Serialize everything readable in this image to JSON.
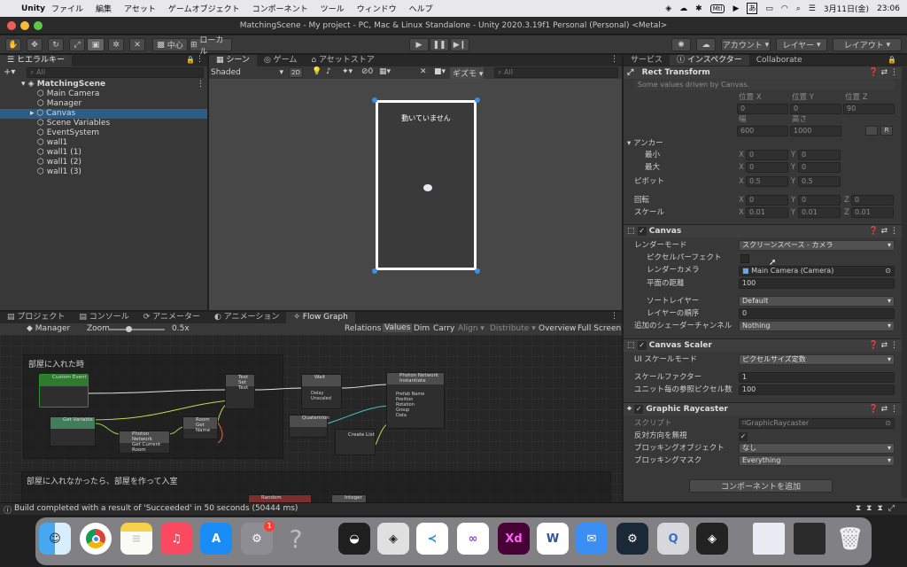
{
  "menubar": {
    "apple": "",
    "app": "Unity",
    "items": [
      "ファイル",
      "編集",
      "アセット",
      "ゲームオブジェクト",
      "コンポーネント",
      "ツール",
      "ウィンドウ",
      "ヘルプ"
    ],
    "date": "3月11日(金)",
    "time": "23:06",
    "input_method": "あ"
  },
  "window": {
    "title": "MatchingScene - My project - PC, Mac & Linux Standalone - Unity 2020.3.19f1 Personal (Personal) <Metal>"
  },
  "toolbar": {
    "pivot": "中心",
    "space": "ローカル",
    "account": "アカウント",
    "layers": "レイヤー",
    "layout": "レイアウト"
  },
  "hierarchy": {
    "tab": "ヒエラルキー",
    "search_placeholder": "All",
    "scene": "MatchingScene",
    "items": [
      "Main Camera",
      "Manager",
      "Canvas",
      "Scene Variables",
      "EventSystem",
      "wall1",
      "wall1 (1)",
      "wall1 (2)",
      "wall1 (3)"
    ],
    "selected": "Canvas"
  },
  "scene": {
    "tabs": [
      "シーン",
      "ゲーム",
      "アセットストア"
    ],
    "mode": "Shaded",
    "btn_2d": "2D",
    "gizmos": "ギズモ",
    "search_placeholder": "All",
    "label": "動いていません"
  },
  "bottom": {
    "tabs": [
      "プロジェクト",
      "コンソール",
      "アニメーター",
      "アニメーション",
      "Flow Graph"
    ],
    "graph_target": "Manager",
    "zoom_label": "Zoom",
    "zoom_value": "0.5x",
    "buttons": [
      "Relations",
      "Values",
      "Dim",
      "Carry",
      "Align ▾",
      "Distribute ▾",
      "Overview",
      "Full Screen"
    ],
    "group1": "部屋に入れた時",
    "group2": "部屋に入れなかったら、部屋を作って入室",
    "nodes": {
      "custom_event": "Custom Event",
      "get_variable": "Get Variable",
      "photon_room": "Photon Network",
      "photon_room_sub": "Get Current Room",
      "room": "Room",
      "room_sub": "Get Name",
      "text": "Text",
      "text_sub": "Set Text",
      "wait": "Wait",
      "wait_p1": "Delay",
      "wait_p2": "Unscaled",
      "quaternion": "Quaternion",
      "create_list": "Create List",
      "inst": "Photon Network",
      "inst_sub": "Instantiate",
      "inst_p1": "Prefab Name",
      "inst_p2": "Position",
      "inst_p3": "Rotation",
      "inst_p4": "Group",
      "inst_p5": "Data",
      "random": "Random",
      "integer": "Integer"
    }
  },
  "statusbar": {
    "message": "Build completed with a result of 'Succeeded' in 50 seconds (50444 ms)"
  },
  "inspector": {
    "tabs": [
      "サービス",
      "インスペクター",
      "Collaborate"
    ],
    "rect": {
      "title": "Rect Transform",
      "note": "Some values driven by Canvas.",
      "pos_x_label": "位置 X",
      "pos_y_label": "位置 Y",
      "pos_z_label": "位置 Z",
      "pos_x": "0",
      "pos_y": "0",
      "pos_z": "90",
      "w_label": "幅",
      "h_label": "高さ",
      "w": "600",
      "h": "1000",
      "r_btn": "R",
      "anchor": "アンカー",
      "min": "最小",
      "max": "最大",
      "min_x": "0",
      "min_y": "0",
      "max_x": "0",
      "max_y": "0",
      "pivot": "ピボット",
      "pivot_x": "0.5",
      "pivot_y": "0.5",
      "rotation": "回転",
      "rot_x": "0",
      "rot_y": "0",
      "rot_z": "0",
      "scale": "スケール",
      "sx": "0.01",
      "sy": "0.01",
      "sz": "0.01",
      "x": "X",
      "y": "Y",
      "z": "Z"
    },
    "canvas": {
      "title": "Canvas",
      "render_mode_label": "レンダーモード",
      "render_mode": "スクリーンスペース - カメラ",
      "pixel_perfect": "ピクセルパーフェクト",
      "render_camera_label": "レンダーカメラ",
      "render_camera": "Main Camera (Camera)",
      "plane_distance_label": "平面の距離",
      "plane_distance": "100",
      "sorting_layer_label": "ソートレイヤー",
      "sorting_layer": "Default",
      "order_label": "レイヤーの順序",
      "order": "0",
      "shader_channels_label": "追加のシェーダーチャンネル",
      "shader_channels": "Nothing"
    },
    "scaler": {
      "title": "Canvas Scaler",
      "ui_scale_label": "UI スケールモード",
      "ui_scale": "ピクセルサイズ定数",
      "scale_factor_label": "スケールファクター",
      "scale_factor": "1",
      "ppu_label": "ユニット毎の参照ピクセル数",
      "ppu": "100"
    },
    "raycaster": {
      "title": "Graphic Raycaster",
      "script_label": "スクリプト",
      "script": "GraphicRaycaster",
      "ignore_reversed": "反対方向を無視",
      "blocking_objects_label": "ブロッキングオブジェクト",
      "blocking_objects": "なし",
      "blocking_mask_label": "ブロッキングマスク",
      "blocking_mask": "Everything"
    },
    "add_component": "コンポーネントを追加"
  },
  "dock": {
    "badge": "1",
    "apps": [
      "Finder",
      "Chrome",
      "Notes",
      "Music",
      "App Store",
      "System Preferences",
      "Help",
      "Unity Hub",
      "Unity",
      "VS Code",
      "Visual Studio",
      "Adobe XD",
      "Word",
      "Mail",
      "Steam",
      "QuickTime",
      "Unity",
      "Preview",
      "Screenshot",
      "Trash"
    ]
  },
  "colors": {
    "selection": "#2c5d87",
    "panel": "#383838",
    "accent_blue": "#3c8ee6"
  }
}
